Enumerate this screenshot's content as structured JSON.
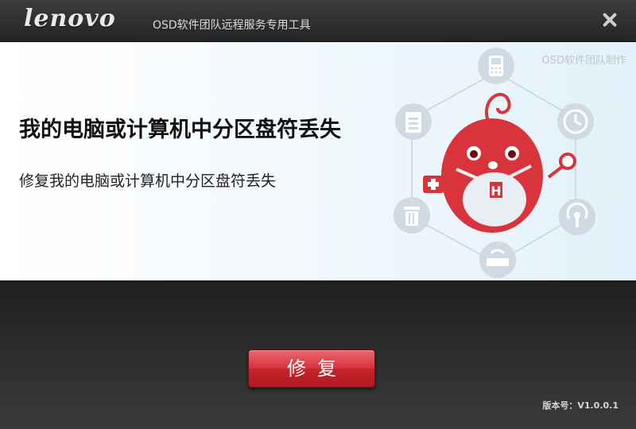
{
  "window": {
    "brand": "lenovo",
    "title": "OSD软件团队远程服务专用工具"
  },
  "banner": {
    "credit": "OSD软件团队制作",
    "headline": "我的电脑或计算机中分区盘符丢失",
    "description": "修复我的电脑或计算机中分区盘符丢失"
  },
  "illustration": {
    "icons": [
      "phone-icon",
      "clock-icon",
      "wifi-icon",
      "router-icon",
      "trash-icon",
      "document-icon",
      "first-aid-icon",
      "search-icon"
    ],
    "mascot_badge": "H"
  },
  "footer": {
    "repair_label": "修复",
    "version": "版本号：V1.0.0.1"
  },
  "colors": {
    "accent_red": "#d9333c",
    "icon_gray": "#b7c4d1"
  }
}
